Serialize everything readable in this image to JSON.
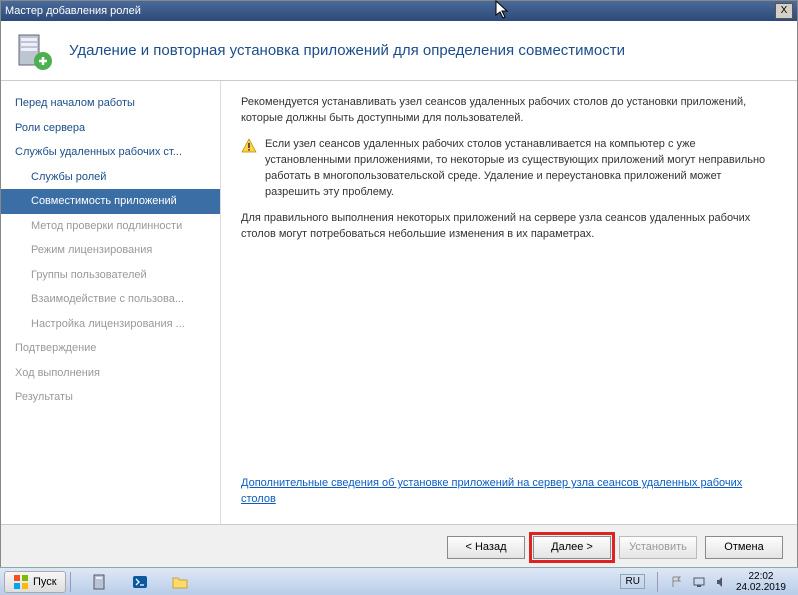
{
  "window": {
    "title": "Мастер добавления ролей",
    "close_label": "X"
  },
  "header": {
    "title": "Удаление и повторная установка приложений для определения совместимости"
  },
  "sidebar": {
    "items": [
      {
        "label": "Перед началом работы",
        "child": false,
        "disabled": false,
        "selected": false
      },
      {
        "label": "Роли сервера",
        "child": false,
        "disabled": false,
        "selected": false
      },
      {
        "label": "Службы удаленных рабочих ст...",
        "child": false,
        "disabled": false,
        "selected": false
      },
      {
        "label": "Службы ролей",
        "child": true,
        "disabled": false,
        "selected": false
      },
      {
        "label": "Совместимость приложений",
        "child": true,
        "disabled": false,
        "selected": true
      },
      {
        "label": "Метод проверки подлинности",
        "child": true,
        "disabled": true,
        "selected": false
      },
      {
        "label": "Режим лицензирования",
        "child": true,
        "disabled": true,
        "selected": false
      },
      {
        "label": "Группы пользователей",
        "child": true,
        "disabled": true,
        "selected": false
      },
      {
        "label": "Взаимодействие с пользова...",
        "child": true,
        "disabled": true,
        "selected": false
      },
      {
        "label": "Настройка лицензирования ...",
        "child": true,
        "disabled": true,
        "selected": false
      },
      {
        "label": "Подтверждение",
        "child": false,
        "disabled": true,
        "selected": false
      },
      {
        "label": "Ход выполнения",
        "child": false,
        "disabled": true,
        "selected": false
      },
      {
        "label": "Результаты",
        "child": false,
        "disabled": true,
        "selected": false
      }
    ]
  },
  "content": {
    "para1": "Рекомендуется устанавливать узел сеансов удаленных рабочих столов до установки приложений, которые должны быть доступными для пользователей.",
    "warning": "Если узел сеансов удаленных рабочих столов устанавливается на компьютер с уже установленными приложениями, то некоторые из существующих приложений могут неправильно работать в многопользовательской среде. Удаление и переустановка приложений может разрешить эту проблему.",
    "para2": "Для правильного выполнения некоторых приложений на сервере узла сеансов удаленных рабочих столов могут потребоваться небольшие изменения в их параметрах.",
    "link": "Дополнительные сведения об установке приложений на сервер узла сеансов удаленных рабочих столов"
  },
  "footer": {
    "back": "< Назад",
    "next": "Далее >",
    "install": "Установить",
    "cancel": "Отмена"
  },
  "taskbar": {
    "start": "Пуск",
    "lang": "RU",
    "time": "22:02",
    "date": "24.02.2019"
  }
}
